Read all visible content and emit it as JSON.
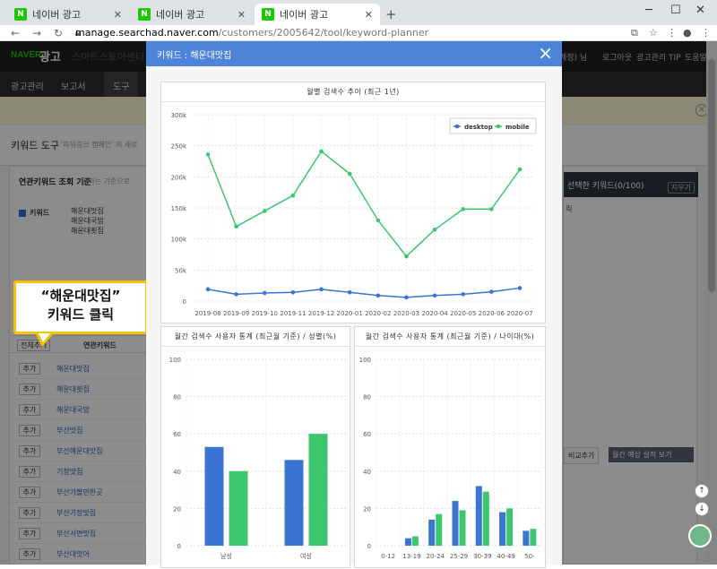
{
  "browser": {
    "tabs": [
      {
        "title": "네이버 광고",
        "favicon": "N"
      },
      {
        "title": "네이버 광고",
        "favicon": "N"
      },
      {
        "title": "네이버 광고",
        "favicon": "N"
      }
    ],
    "active_tab": 2,
    "url_host": "manage.searchad.naver.com",
    "url_path": "/customers/2005642/tool/keyword-planner"
  },
  "naver_header": {
    "logo": "NAVER",
    "logo_suffix": "광고",
    "smartstore": "스마트스토어센터",
    "account_suffix": "계정) 님",
    "logout": "로그아웃",
    "tips": "광고관리 TIP",
    "help": "도움말"
  },
  "menu": {
    "items": [
      "광고관리",
      "보고서",
      "도구"
    ]
  },
  "page": {
    "title": "키워드 도구",
    "subtitle": "'파워링크 캠페인' 의 새로"
  },
  "left_panel": {
    "title": "연관키워드 조회 기준",
    "subtitle": "원하는 기준으로",
    "keyword_label": "키워드",
    "keywords": [
      "해운대맛집",
      "해운대국밥",
      "해운대횟집"
    ],
    "all_add": "전체추가",
    "column_header": "연관키워드",
    "add_label": "추가",
    "rows": [
      "해운대맛집",
      "해운대횟집",
      "해운대국밥",
      "부산맛집",
      "부산해운대맛집",
      "기장맛집",
      "부산가볼만한곳",
      "부산기장맛집",
      "부산서면맛집",
      "부산대맛어"
    ]
  },
  "right_panel": {
    "title": "선택한 키워드(0/100)",
    "clear": "지우기",
    "text": "릭",
    "btn_add": "비교추가",
    "btn_plan": "월간 예상 실적 보기"
  },
  "callout": {
    "line1": "“해운대맛집”",
    "line2": "키워드 클릭"
  },
  "modal": {
    "title": "키워드 : 해운대맛집",
    "close_icon": "×"
  },
  "chart_data": [
    {
      "type": "line",
      "title": "월별 검색수 추이 (최근 1년)",
      "x": [
        "2019-08",
        "2019-09",
        "2019-10",
        "2019-11",
        "2019-12",
        "2020-01",
        "2020-02",
        "2020-03",
        "2020-04",
        "2020-05",
        "2020-06",
        "2020-07"
      ],
      "yticks": [
        "0",
        "50k",
        "100k",
        "150k",
        "200k",
        "250k",
        "300k"
      ],
      "ylim": [
        0,
        300000
      ],
      "legend_position": "top-right",
      "series": [
        {
          "name": "desktop",
          "color": "#3a75d4",
          "values": [
            19000,
            11000,
            13000,
            14000,
            19000,
            14000,
            9000,
            6000,
            9000,
            11000,
            15000,
            21000
          ]
        },
        {
          "name": "mobile",
          "color": "#3cc76e",
          "values": [
            236000,
            120000,
            145000,
            170000,
            241000,
            205000,
            130000,
            72000,
            115000,
            148000,
            148000,
            212000
          ]
        }
      ]
    },
    {
      "type": "bar",
      "title": "월간 검색수 사용자 통계 (최근월 기준) / 성별(%)",
      "categories": [
        "남성",
        "여성"
      ],
      "ylim": [
        0,
        100
      ],
      "yticks": [
        "0",
        "20",
        "40",
        "60",
        "80",
        "100"
      ],
      "series": [
        {
          "name": "desktop",
          "color": "#3a75d4",
          "values": [
            53,
            46
          ]
        },
        {
          "name": "mobile",
          "color": "#3cc76e",
          "values": [
            40,
            60
          ]
        }
      ]
    },
    {
      "type": "bar",
      "title": "월간 검색수 사용자 통계 (최근월 기준) / 나이대(%)",
      "categories": [
        "0-12",
        "13-19",
        "20-24",
        "25-29",
        "30-39",
        "40-49",
        "50-"
      ],
      "ylim": [
        0,
        100
      ],
      "yticks": [
        "0",
        "20",
        "40",
        "60",
        "80",
        "100"
      ],
      "series": [
        {
          "name": "desktop",
          "color": "#3a75d4",
          "values": [
            0,
            4,
            14,
            24,
            32,
            18,
            8
          ]
        },
        {
          "name": "mobile",
          "color": "#3cc76e",
          "values": [
            0,
            5,
            17,
            19,
            29,
            20,
            9
          ]
        }
      ]
    }
  ]
}
